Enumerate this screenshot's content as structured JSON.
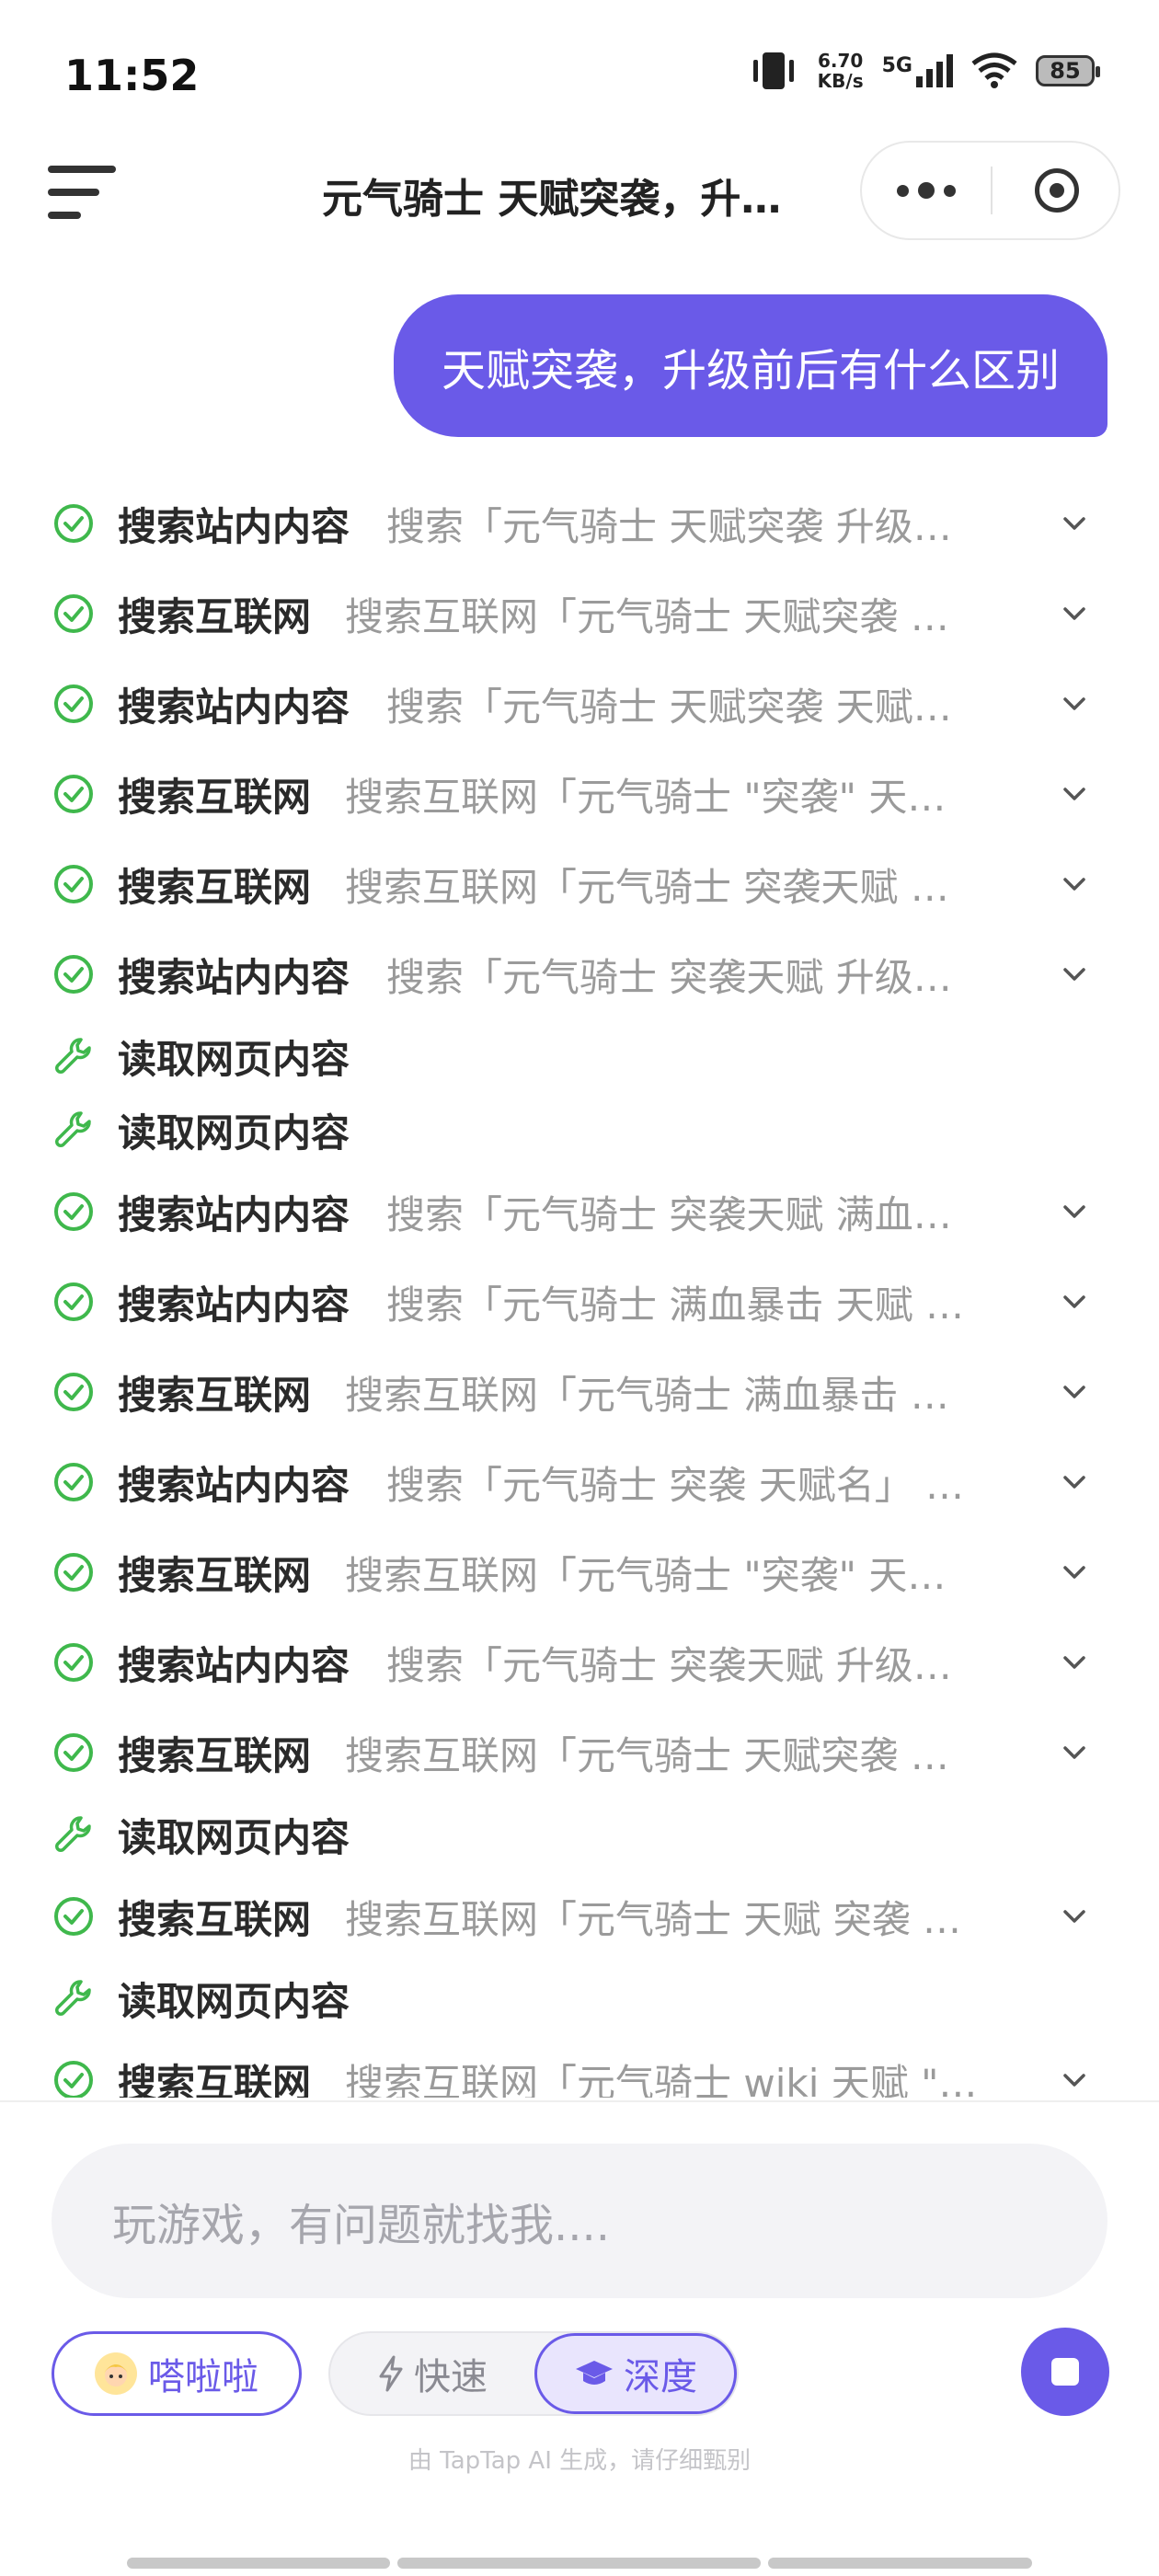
{
  "status_bar": {
    "time": "11:52",
    "net_speed_value": "6.70",
    "net_speed_unit": "KB/s",
    "network": "5G",
    "battery": "85"
  },
  "header": {
    "title": "元气骑士 天赋突袭，升…"
  },
  "user_message": "天赋突袭，升级前后有什么区别",
  "steps": [
    {
      "type": "search",
      "name": "搜索站内内容",
      "query": "搜索「元气骑士 天赋突袭 升级…"
    },
    {
      "type": "search",
      "name": "搜索互联网",
      "query": "搜索互联网「元气骑士 天赋突袭 …"
    },
    {
      "type": "search",
      "name": "搜索站内内容",
      "query": "搜索「元气骑士 天赋突袭 天赋…"
    },
    {
      "type": "search",
      "name": "搜索互联网",
      "query": "搜索互联网「元气骑士 \"突袭\" 天…"
    },
    {
      "type": "search",
      "name": "搜索互联网",
      "query": "搜索互联网「元气骑士 突袭天赋 …"
    },
    {
      "type": "search",
      "name": "搜索站内内容",
      "query": "搜索「元气骑士 突袭天赋 升级…"
    },
    {
      "type": "read",
      "name": "读取网页内容",
      "query": ""
    },
    {
      "type": "read",
      "name": "读取网页内容",
      "query": ""
    },
    {
      "type": "search",
      "name": "搜索站内内容",
      "query": "搜索「元气骑士 突袭天赋 满血…"
    },
    {
      "type": "search",
      "name": "搜索站内内容",
      "query": "搜索「元气骑士 满血暴击 天赋 …"
    },
    {
      "type": "search",
      "name": "搜索互联网",
      "query": "搜索互联网「元气骑士 满血暴击 …"
    },
    {
      "type": "search",
      "name": "搜索站内内容",
      "query": "搜索「元气骑士 突袭 天赋名」 …"
    },
    {
      "type": "search",
      "name": "搜索互联网",
      "query": "搜索互联网「元气骑士 \"突袭\" 天…"
    },
    {
      "type": "search",
      "name": "搜索站内内容",
      "query": "搜索「元气骑士 突袭天赋 升级…"
    },
    {
      "type": "search",
      "name": "搜索互联网",
      "query": "搜索互联网「元气骑士 天赋突袭 …"
    },
    {
      "type": "read",
      "name": "读取网页内容",
      "query": ""
    },
    {
      "type": "search",
      "name": "搜索互联网",
      "query": "搜索互联网「元气骑士 天赋 突袭 …"
    },
    {
      "type": "read",
      "name": "读取网页内容",
      "query": ""
    },
    {
      "type": "search",
      "name": "搜索互联网",
      "query": "搜索互联网「元气骑士 wiki 天赋 \"…"
    }
  ],
  "composer": {
    "placeholder": "玩游戏，有问题就找我....",
    "agent_label": "嗒啦啦",
    "mode_fast": "快速",
    "mode_deep": "深度",
    "selected_mode": "深度",
    "disclaimer": "由 TapTap AI 生成，请仔细甄别"
  },
  "colors": {
    "accent": "#6a5ae8",
    "success": "#3fb84c"
  }
}
